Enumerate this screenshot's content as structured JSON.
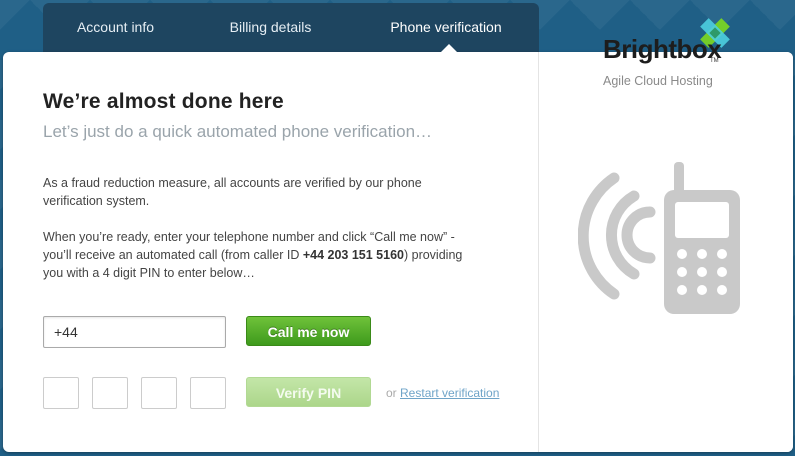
{
  "tabs": [
    {
      "label": "Account info"
    },
    {
      "label": "Billing details"
    },
    {
      "label": "Phone verification"
    }
  ],
  "main": {
    "title": "We’re almost done here",
    "subtitle": "Let’s just do a quick automated phone verification…",
    "para1": "As a fraud reduction measure, all accounts are verified by our phone verification system.",
    "para2_part1": "When you’re ready, enter your telephone number and click “Call me now” - you’ll receive an automated call (from caller ID ",
    "caller_id": "+44 203 151 5160",
    "para2_part2": ") providing you with a 4 digit PIN to enter below…"
  },
  "form": {
    "phone_value": "+44",
    "call_button": "Call me now",
    "verify_button": "Verify PIN",
    "or_text": "or",
    "restart_link": "Restart verification"
  },
  "brand": {
    "name": "Brightbox",
    "tm": "TM",
    "tagline": "Agile Cloud Hosting"
  },
  "colors": {
    "accent_green": "#4caf24",
    "tab_bg": "#1e4560",
    "link": "#6fa4c8"
  },
  "icons": [
    "brightbox-logo-icon",
    "phone-signal-icon"
  ]
}
